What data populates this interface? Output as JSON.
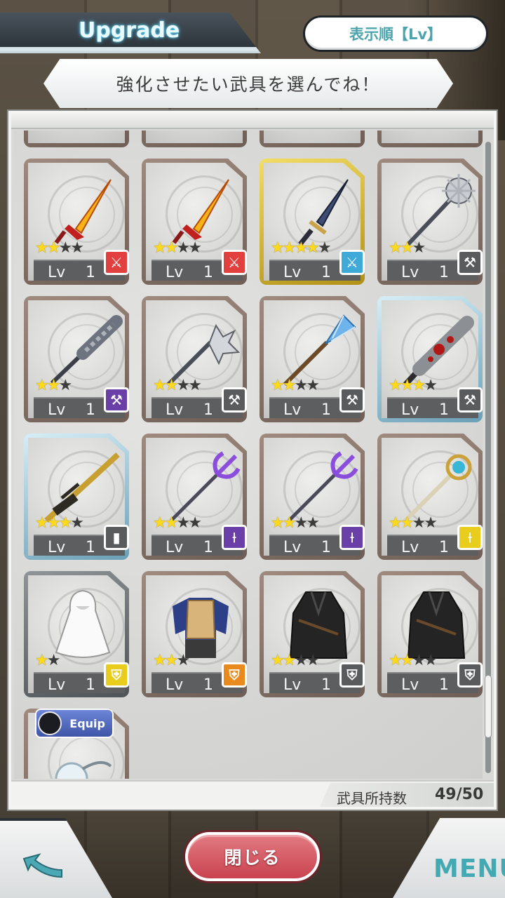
{
  "header": {
    "title": "Upgrade",
    "sort_label": "表示順【Lv】",
    "instruction": "強化させたい武具を選んでね！"
  },
  "inventory": {
    "items": [
      {
        "name": "flame-sword",
        "stars": 2,
        "max_stars": 4,
        "level_label": "Lv",
        "level": "1",
        "frame": "bronze",
        "badge": "red-sword"
      },
      {
        "name": "flame-sword",
        "stars": 2,
        "max_stars": 4,
        "level_label": "Lv",
        "level": "1",
        "frame": "bronze",
        "badge": "red-sword"
      },
      {
        "name": "dark-sword",
        "stars": 4,
        "max_stars": 5,
        "level_label": "Lv",
        "level": "1",
        "frame": "gold",
        "badge": "blue-sword"
      },
      {
        "name": "spiked-mace",
        "stars": 2,
        "max_stars": 3,
        "level_label": "Lv",
        "level": "1",
        "frame": "bronze",
        "badge": "gray-mace"
      },
      {
        "name": "twisted-mace",
        "stars": 2,
        "max_stars": 3,
        "level_label": "Lv",
        "level": "1",
        "frame": "bronze",
        "badge": "purple-mace"
      },
      {
        "name": "flanged-mace",
        "stars": 2,
        "max_stars": 4,
        "level_label": "Lv",
        "level": "1",
        "frame": "bronze",
        "badge": "gray-mace"
      },
      {
        "name": "ice-mace",
        "stars": 2,
        "max_stars": 4,
        "level_label": "Lv",
        "level": "1",
        "frame": "bronze",
        "badge": "gray-mace"
      },
      {
        "name": "bloody-club",
        "stars": 3,
        "max_stars": 4,
        "level_label": "Lv",
        "level": "1",
        "frame": "blue",
        "badge": "gray-mace"
      },
      {
        "name": "golden-rifle",
        "stars": 3,
        "max_stars": 4,
        "level_label": "Lv",
        "level": "1",
        "frame": "blue",
        "badge": "gray-gun"
      },
      {
        "name": "purple-trident",
        "stars": 2,
        "max_stars": 4,
        "level_label": "Lv",
        "level": "1",
        "frame": "bronze",
        "badge": "purple-staff"
      },
      {
        "name": "purple-trident",
        "stars": 2,
        "max_stars": 4,
        "level_label": "Lv",
        "level": "1",
        "frame": "bronze",
        "badge": "purple-staff"
      },
      {
        "name": "crystal-staff",
        "stars": 2,
        "max_stars": 4,
        "level_label": "Lv",
        "level": "1",
        "frame": "bronze",
        "badge": "yellow-staff"
      },
      {
        "name": "white-cloak",
        "stars": 1,
        "max_stars": 2,
        "level_label": "Lv",
        "level": "1",
        "frame": "gray",
        "badge": "yellow-armor"
      },
      {
        "name": "leather-armor",
        "stars": 2,
        "max_stars": 3,
        "level_label": "Lv",
        "level": "1",
        "frame": "bronze",
        "badge": "orange-armor"
      },
      {
        "name": "black-coat",
        "stars": 2,
        "max_stars": 4,
        "level_label": "Lv",
        "level": "1",
        "frame": "bronze",
        "badge": "gray-armor"
      },
      {
        "name": "black-coat",
        "stars": 2,
        "max_stars": 4,
        "level_label": "Lv",
        "level": "1",
        "frame": "bronze",
        "badge": "gray-armor"
      },
      {
        "name": "crystal-accessory",
        "stars": 0,
        "max_stars": 0,
        "level_label": "",
        "level": "",
        "frame": "bronze",
        "badge": "",
        "equipped": true
      }
    ],
    "equip_label": "Equip",
    "own_label": "武具所持数",
    "own_count": "49/50"
  },
  "footer": {
    "close_label": "閉じる",
    "menu_label": "MENU"
  },
  "colors": {
    "badge_red": "#e2403f",
    "badge_blue": "#3fa9d8",
    "badge_gray": "#5a5b5c",
    "badge_purple": "#6a3fa8",
    "badge_yellow": "#e8cd1c",
    "badge_orange": "#e88a1c",
    "accent_teal": "#43a9b3",
    "close_red": "#c9434f"
  }
}
